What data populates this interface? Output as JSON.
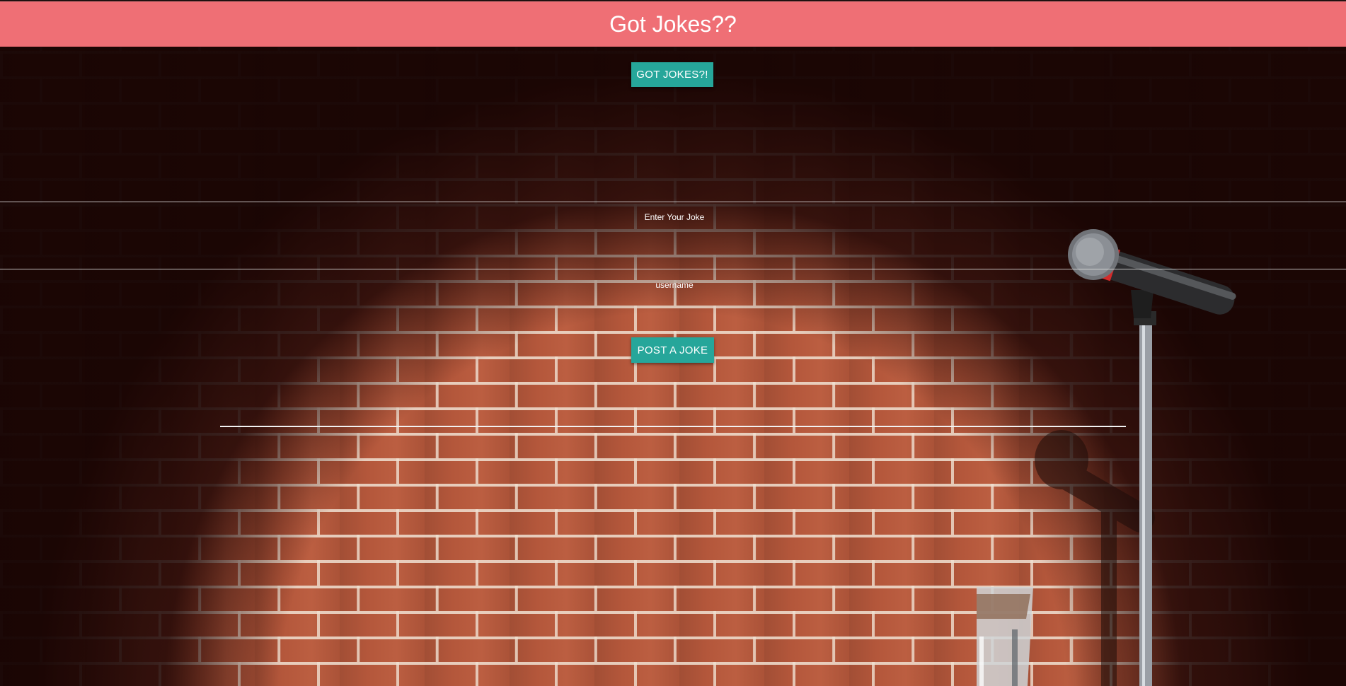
{
  "header": {
    "title": "Got Jokes??"
  },
  "actions": {
    "got_jokes_label": "GOT JOKES?!",
    "post_joke_label": "POST A JOKE"
  },
  "form": {
    "joke": {
      "placeholder": "Enter Your Joke",
      "value": ""
    },
    "username": {
      "placeholder": "username",
      "value": ""
    }
  },
  "colors": {
    "header_bg": "#ef6f75",
    "button_bg": "#26a69a",
    "text": "#ffffff",
    "brick": "#b4573b"
  },
  "background": {
    "scene": "brick-wall-stage",
    "icons": [
      "microphone-icon",
      "water-glass-icon"
    ]
  }
}
